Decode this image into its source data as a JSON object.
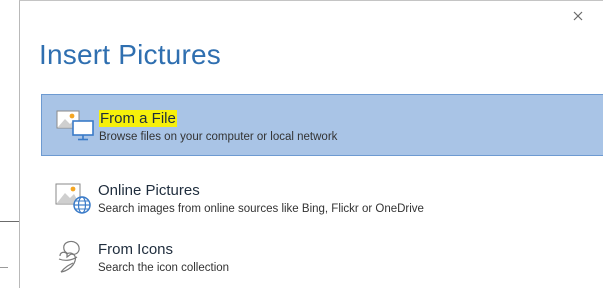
{
  "dialog": {
    "title": "Insert Pictures",
    "close_icon": "close-icon",
    "options": [
      {
        "title": "From a File",
        "description": "Browse files on your computer or local network",
        "icon": "picture-on-computer-icon",
        "selected": true,
        "title_highlight": "#f7f00a"
      },
      {
        "title": "Online Pictures",
        "description": "Search images from online sources like Bing, Flickr or OneDrive",
        "icon": "picture-with-globe-icon",
        "selected": false
      },
      {
        "title": "From Icons",
        "description": "Search the icon collection",
        "icon": "icon-collection-icon",
        "selected": false
      }
    ]
  },
  "colors": {
    "title": "#2f6fb0",
    "selected_background": "#a9c4e6",
    "selected_border": "#6d9ad1",
    "icon_blue": "#3a7bc8"
  }
}
